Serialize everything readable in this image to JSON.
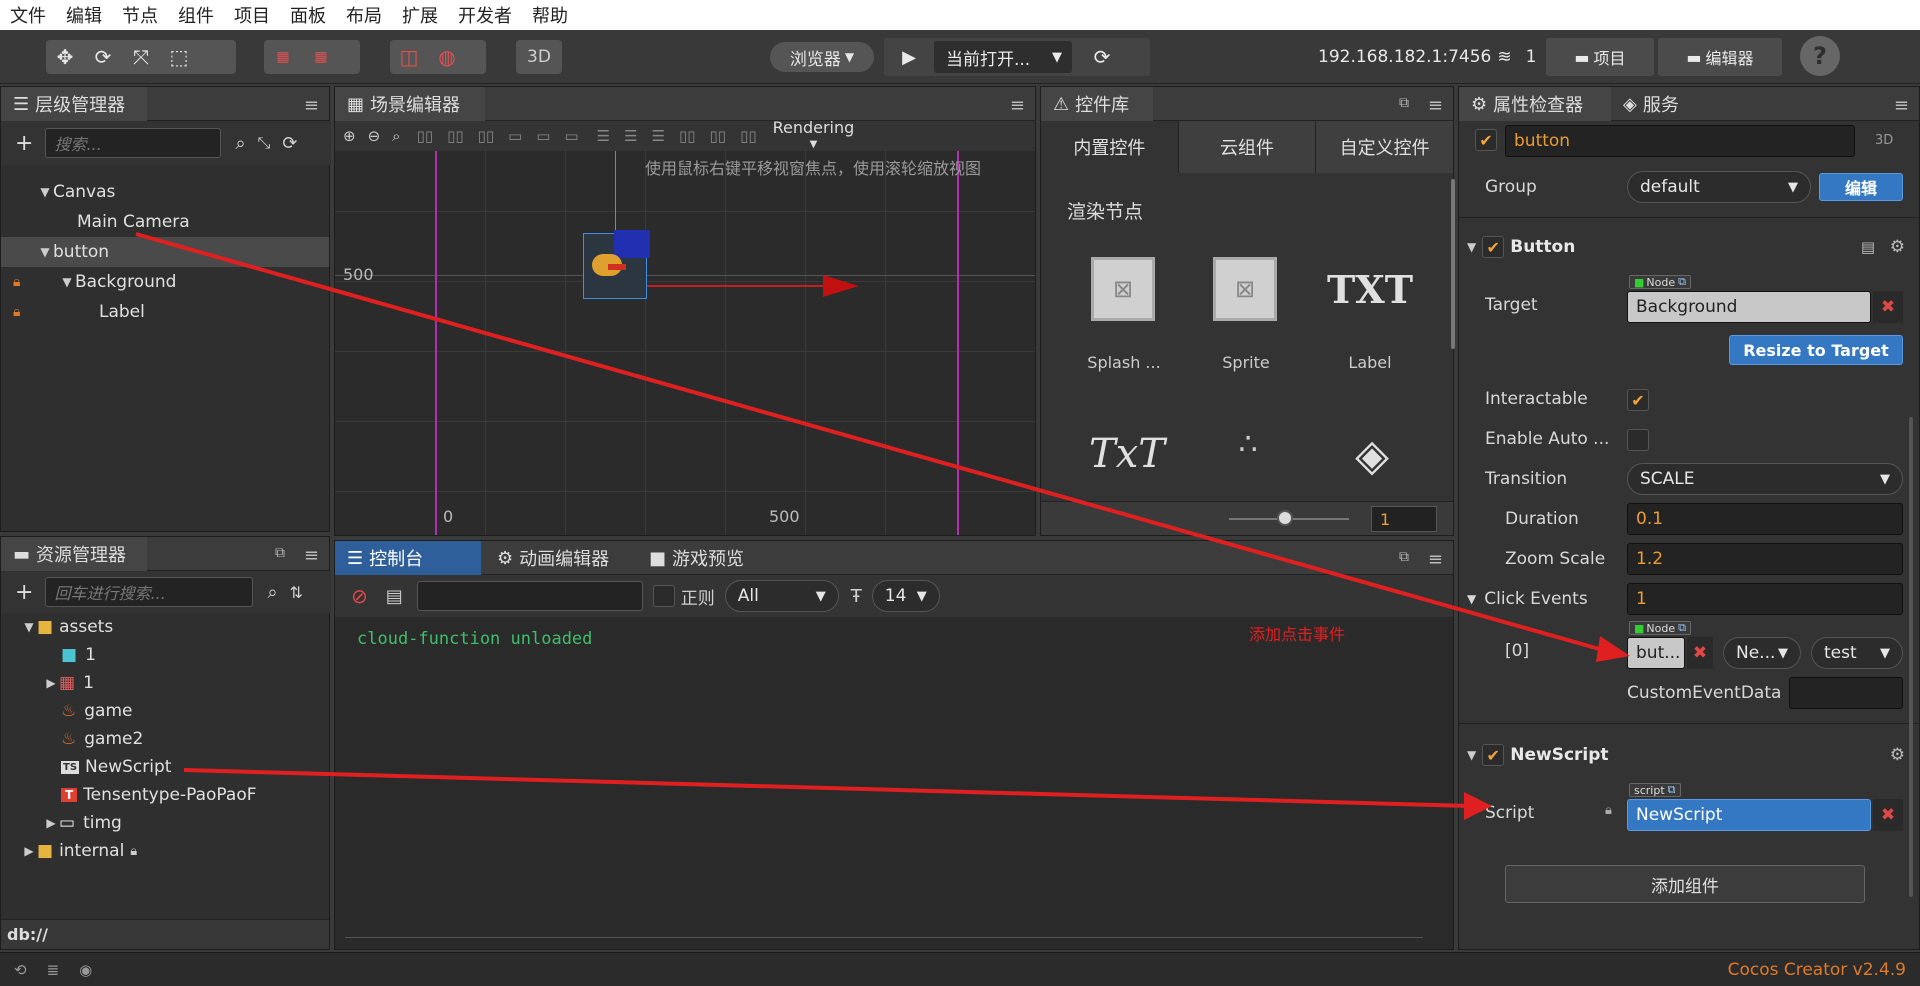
{
  "menu": [
    "文件",
    "编辑",
    "节点",
    "组件",
    "项目",
    "面板",
    "布局",
    "扩展",
    "开发者",
    "帮助"
  ],
  "toolbar": {
    "btn_3d": "3D",
    "browser": "浏览器",
    "current_open": "当前打开...",
    "ip": "192.168.182.1:7456",
    "clients": "1",
    "project": "项目",
    "editor": "编辑器",
    "help": "?"
  },
  "hierarchy": {
    "title": "层级管理器",
    "search_placeholder": "搜索...",
    "items": [
      {
        "label": "Canvas"
      },
      {
        "label": "Main Camera"
      },
      {
        "label": "button"
      },
      {
        "label": "Background"
      },
      {
        "label": "Label"
      }
    ]
  },
  "scene": {
    "title": "场景编辑器",
    "rendering": "Rendering",
    "hint": "使用鼠标右键平移视窗焦点，使用滚轮缩放视图",
    "label_y500": "500",
    "label_x0": "0",
    "label_x500": "500"
  },
  "widgets": {
    "title": "控件库",
    "tabs": [
      "内置控件",
      "云组件",
      "自定义控件"
    ],
    "section": "渲染节点",
    "items": [
      {
        "label": "Splash ..."
      },
      {
        "label": "Sprite"
      },
      {
        "label": "Label"
      }
    ],
    "glyph_txt": "TXT",
    "glyph_richtext": "TxT",
    "slider_value": "1"
  },
  "assets": {
    "title": "资源管理器",
    "search_placeholder": "回车进行搜索...",
    "items": [
      {
        "label": "assets"
      },
      {
        "label": "1"
      },
      {
        "label": "1"
      },
      {
        "label": "game"
      },
      {
        "label": "game2"
      },
      {
        "label": "NewScript"
      },
      {
        "label": "Tensentype-PaoPaoF"
      },
      {
        "label": "timg"
      },
      {
        "label": "internal"
      }
    ],
    "footer": "db://"
  },
  "console": {
    "tabs": [
      "控制台",
      "动画编辑器",
      "游戏预览"
    ],
    "regex": "正则",
    "filter": "All",
    "font_size": "14",
    "log": "cloud-function unloaded",
    "annotation": "添加点击事件"
  },
  "inspector": {
    "tabs": [
      "属性检查器",
      "服务"
    ],
    "node_name": "button",
    "label_3d": "3D",
    "group_label": "Group",
    "group_value": "default",
    "edit_btn": "编辑",
    "button_section": "Button",
    "target_label": "Target",
    "node_tag": "Node",
    "target_value": "Background",
    "resize_btn": "Resize to Target",
    "interactable_label": "Interactable",
    "enable_auto_label": "Enable Auto ...",
    "transition_label": "Transition",
    "transition_value": "SCALE",
    "duration_label": "Duration",
    "duration_value": "0.1",
    "zoom_label": "Zoom Scale",
    "zoom_value": "1.2",
    "click_events_label": "Click Events",
    "click_events_value": "1",
    "event_index": "[0]",
    "event_target": "but...",
    "event_component": "Ne...",
    "event_handler": "test",
    "custom_data_label": "CustomEventData",
    "script_section": "NewScript",
    "script_label": "Script",
    "script_tag": "script",
    "script_value": "NewScript",
    "add_component": "添加组件"
  },
  "status": {
    "version": "Cocos Creator v2.4.9"
  },
  "colors": {
    "accent_orange": "#ea9d33",
    "accent_blue": "#3477c2",
    "annotation_red": "#e02020",
    "log_green": "#3fbf6a"
  }
}
